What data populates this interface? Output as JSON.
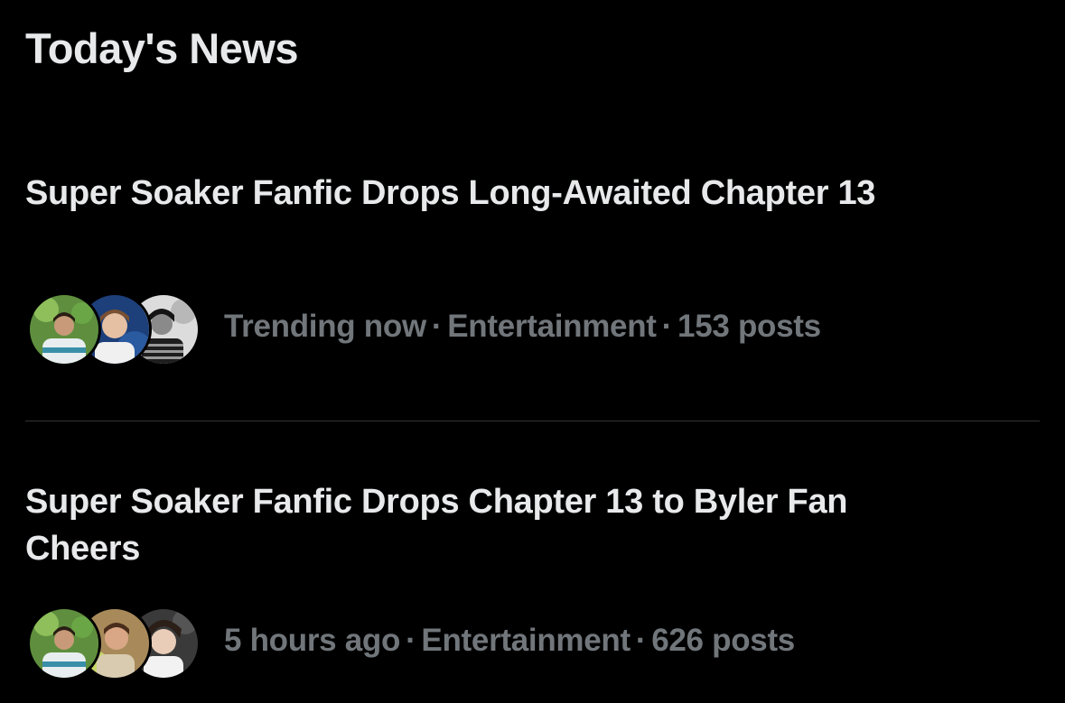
{
  "section": {
    "title": "Today's News"
  },
  "news": [
    {
      "headline": "Super Soaker Fanfic Drops Long-Awaited Chapter 13",
      "time": "Trending now",
      "category": "Entertainment",
      "posts": "153 posts",
      "separator": "·"
    },
    {
      "headline": "Super Soaker Fanfic Drops Chapter 13 to Byler Fan Cheers",
      "time": "5 hours ago",
      "category": "Entertainment",
      "posts": "626 posts",
      "separator": "·"
    }
  ],
  "colors": {
    "background": "#000000",
    "headline_text": "#e7e9ea",
    "meta_text": "#71767b",
    "divider": "#2f3336"
  }
}
